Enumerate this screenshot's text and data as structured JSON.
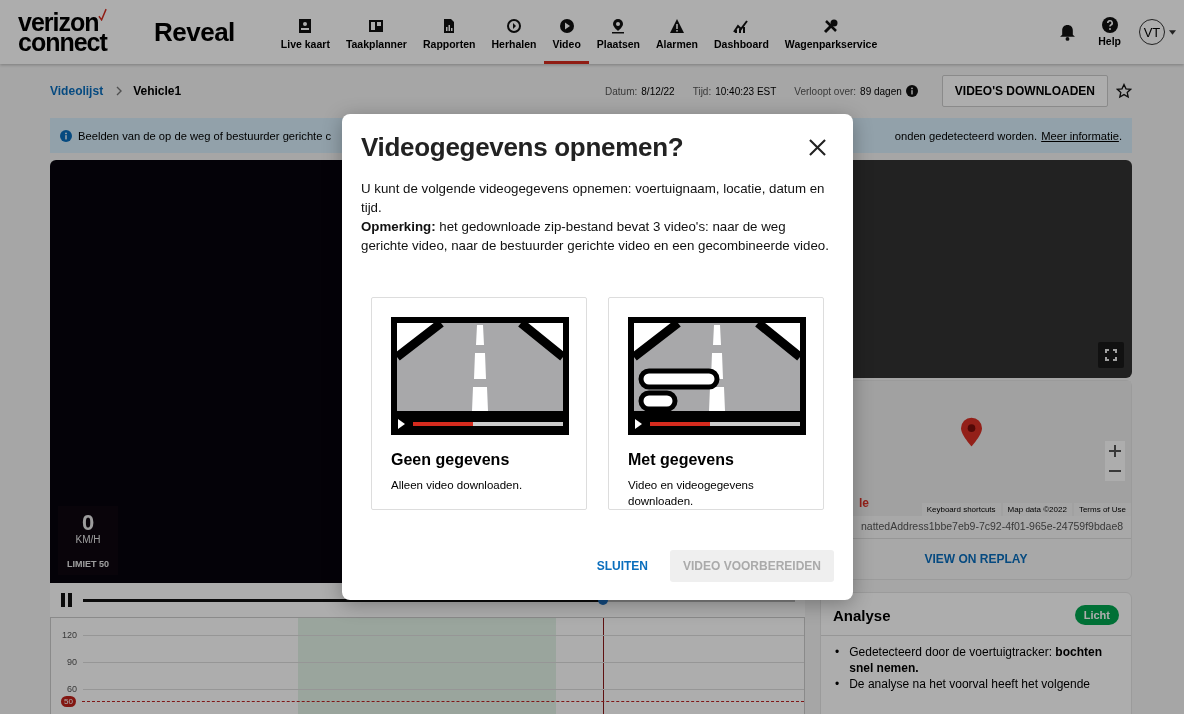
{
  "header": {
    "logo": {
      "line1": "verizon",
      "line2": "connect"
    },
    "product": "Reveal",
    "nav": [
      {
        "label": "Live kaart",
        "selected": false
      },
      {
        "label": "Taakplanner",
        "selected": false
      },
      {
        "label": "Rapporten",
        "selected": false
      },
      {
        "label": "Herhalen",
        "selected": false
      },
      {
        "label": "Video",
        "selected": true
      },
      {
        "label": "Plaatsen",
        "selected": false
      },
      {
        "label": "Alarmen",
        "selected": false
      },
      {
        "label": "Dashboard",
        "selected": false
      },
      {
        "label": "Wagenparkservice",
        "selected": false
      }
    ],
    "help": "Help",
    "avatar": "VT"
  },
  "breadcrumb": {
    "parent": "Videolijst",
    "current": "Vehicle1"
  },
  "meta": [
    {
      "label": "Datum:",
      "value": "8/12/22"
    },
    {
      "label": "Tijd:",
      "value": "10:40:23 EST"
    },
    {
      "label": "Verloopt over:",
      "value": "89 dagen"
    }
  ],
  "download_button": "VIDEO'S DOWNLOADEN",
  "banner": {
    "text_start": "Beelden van de op de weg of bestuurder gerichte c",
    "text_end": "onden gedetecteerd worden.",
    "link": "Meer informatie",
    "after_link": "."
  },
  "video": {
    "speed": "0",
    "unit": "KM/H",
    "limit": "LIMIET 50",
    "progress": {
      "level": 0.73
    }
  },
  "speed_chart": {
    "y_labels": [
      "120",
      "90",
      "60"
    ],
    "limit_badge": "50"
  },
  "map": {
    "logo_fragment": "le",
    "footer": [
      "Keyboard shortcuts",
      "Map data ©2022",
      "Terms of Use"
    ],
    "address": "nattedAddress1bbe7eb9-7c92-4f01-965e-24759f9bdae8",
    "replay_link": "VIEW ON REPLAY"
  },
  "analysis": {
    "title": "Analyse",
    "badge": "Licht",
    "items": [
      {
        "bullet": "•",
        "text": "Gedetecteerd door de voertuigtracker: **bochten snel nemen.**"
      },
      {
        "bullet": "•",
        "text": "De analyse na het voorval heeft het volgende"
      }
    ]
  },
  "dialog": {
    "title": "Videogegevens opnemen?",
    "intro": "U kunt de volgende videogegevens opnemen: voertuignaam, locatie, datum en tijd.",
    "note": "**Opmerking:** het gedownloade zip-bestand bevat 3 video's: naar de weg gerichte video, naar de bestuurder gerichte video en een gecombineerde video.",
    "options": [
      {
        "kind": "plain",
        "title": "Geen gegevens",
        "description": "Alleen video downloaden.",
        "selected": false
      },
      {
        "kind": "data",
        "title": "Met gegevens",
        "description": "Video en videogegevens downloaden.",
        "selected": false
      }
    ],
    "cancel": "SLUITEN",
    "confirm": {
      "label": "VIDEO VOORBEREIDEN",
      "disabled": true
    }
  }
}
